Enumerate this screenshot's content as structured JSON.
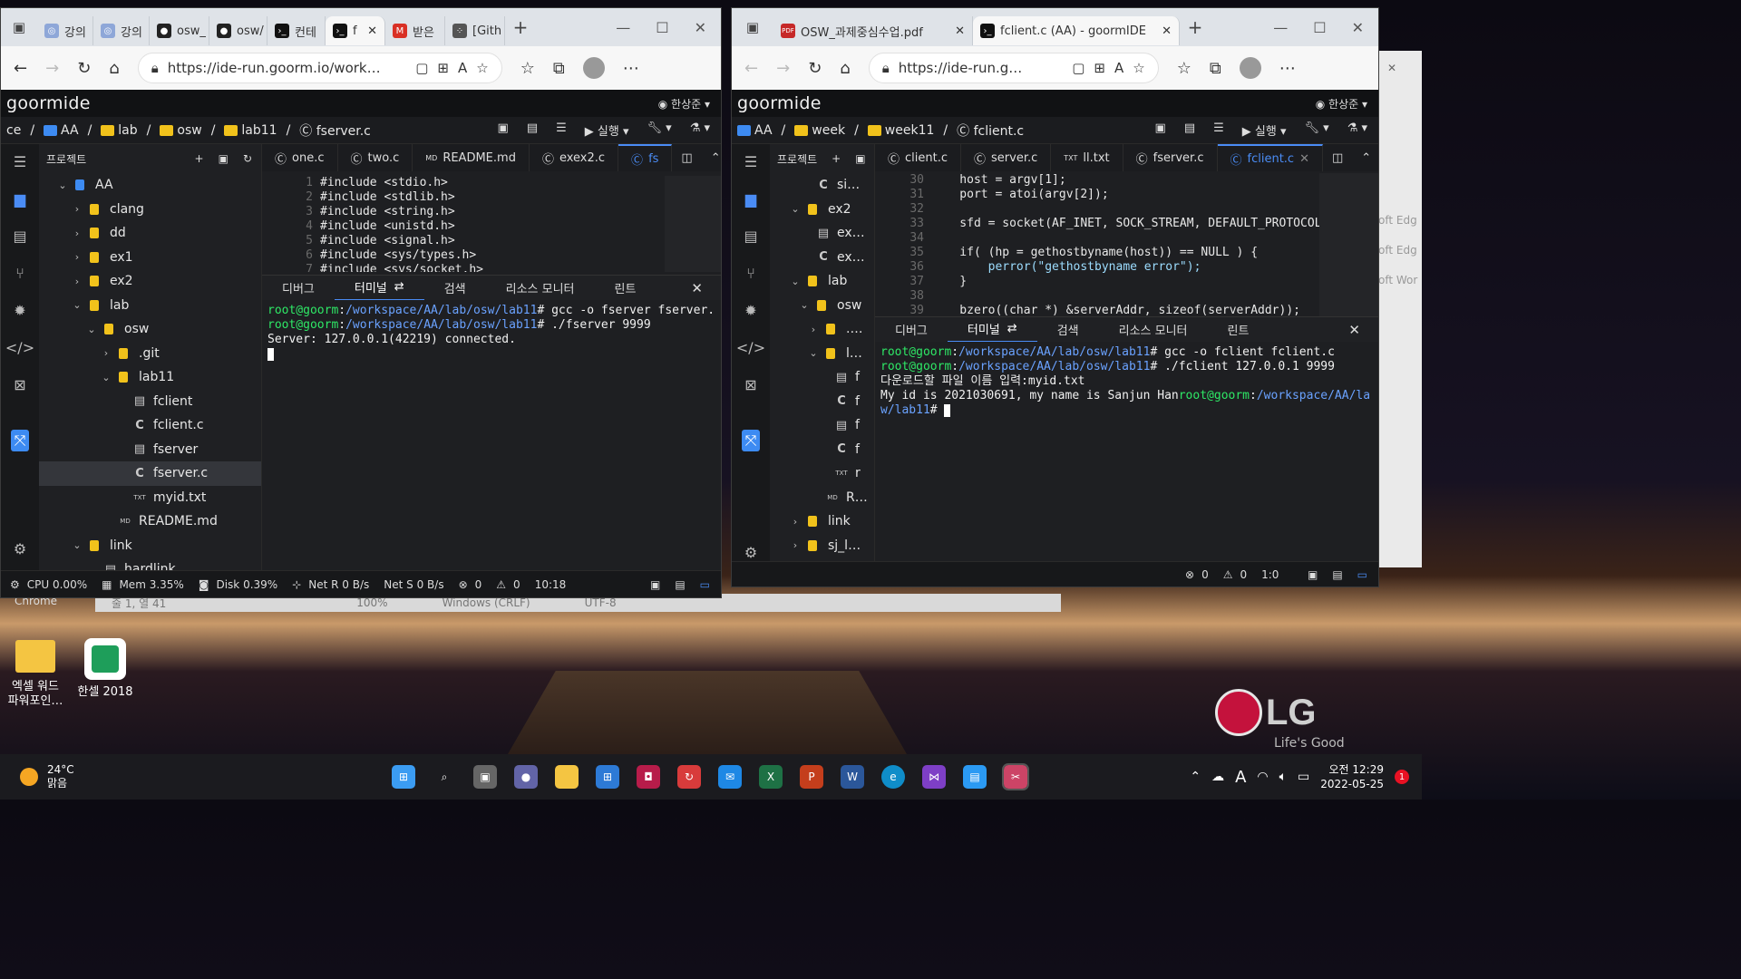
{
  "left": {
    "browser_tabs": [
      "강의",
      "강의",
      "osw_",
      "osw/",
      "컨테",
      "f",
      "받은",
      "[Gith"
    ],
    "url": "https://ide-run.goorm.io/work…",
    "logo": "goormide",
    "user": "한상준",
    "breadcrumb": [
      "ce",
      "AA",
      "lab",
      "osw",
      "lab11",
      "fserver.c"
    ],
    "run_label": "실행",
    "tree_title": "프로젝트",
    "tree": [
      {
        "label": "AA",
        "depth": 0,
        "type": "folder-open",
        "icon": "folder-blue-icon"
      },
      {
        "label": "clang",
        "depth": 1,
        "type": "folder"
      },
      {
        "label": "dd",
        "depth": 1,
        "type": "folder"
      },
      {
        "label": "ex1",
        "depth": 1,
        "type": "folder"
      },
      {
        "label": "ex2",
        "depth": 1,
        "type": "folder"
      },
      {
        "label": "lab",
        "depth": 1,
        "type": "folder-open"
      },
      {
        "label": "osw",
        "depth": 2,
        "type": "folder-open"
      },
      {
        "label": ".git",
        "depth": 3,
        "type": "folder"
      },
      {
        "label": "lab11",
        "depth": 3,
        "type": "folder-open"
      },
      {
        "label": "fclient",
        "depth": 4,
        "type": "file"
      },
      {
        "label": "fclient.c",
        "depth": 4,
        "type": "c"
      },
      {
        "label": "fserver",
        "depth": 4,
        "type": "file"
      },
      {
        "label": "fserver.c",
        "depth": 4,
        "type": "c",
        "selected": true
      },
      {
        "label": "myid.txt",
        "depth": 4,
        "type": "txt"
      },
      {
        "label": "README.md",
        "depth": 3,
        "type": "md"
      },
      {
        "label": "link",
        "depth": 1,
        "type": "folder-open"
      },
      {
        "label": "hardlink",
        "depth": 2,
        "type": "file"
      }
    ],
    "editor_tabs": [
      "one.c",
      "two.c",
      "README.md",
      "exex2.c",
      "fs"
    ],
    "code": [
      {
        "n": "1",
        "t": "#include <stdio.h>"
      },
      {
        "n": "2",
        "t": "#include <stdlib.h>"
      },
      {
        "n": "3",
        "t": "#include <string.h>"
      },
      {
        "n": "4",
        "t": "#include <unistd.h>"
      },
      {
        "n": "5",
        "t": "#include <signal.h>"
      },
      {
        "n": "6",
        "t": "#include <sys/types.h>"
      },
      {
        "n": "7",
        "t": "#include <sys/socket.h>"
      }
    ],
    "panel_tabs": [
      "디버그",
      "터미널",
      "검색",
      "리소스 모니터",
      "린트"
    ],
    "terminal": [
      {
        "user": "root@goorm",
        "path": "/workspace/AA/lab/osw/lab11",
        "cmd": "# gcc -o fserver fserver.c"
      },
      {
        "user": "root@goorm",
        "path": "/workspace/AA/lab/osw/lab11",
        "cmd": "# ./fserver 9999"
      },
      {
        "text": "Server: 127.0.0.1(42219) connected."
      }
    ],
    "status": {
      "cpu": "CPU 0.00%",
      "mem": "Mem 3.35%",
      "disk": "Disk 0.39%",
      "netr": "Net R 0 B/s",
      "nets": "Net S 0 B/s",
      "errors": "0",
      "warnings": "0",
      "pos": "10:18"
    }
  },
  "right": {
    "browser_tabs": [
      "OSW_과제중심수업.pdf",
      "fclient.c (AA) - goormIDE"
    ],
    "url": "https://ide-run.g…",
    "logo": "goormide",
    "user": "한상준",
    "breadcrumb": [
      "AA",
      "week",
      "week11",
      "fclient.c"
    ],
    "run_label": "실행",
    "tree_title": "프로젝트",
    "tree": [
      {
        "label": "si…",
        "depth": 3,
        "type": "c"
      },
      {
        "label": "ex2",
        "depth": 2,
        "type": "folder-open"
      },
      {
        "label": "ex…",
        "depth": 3,
        "type": "file"
      },
      {
        "label": "ex…",
        "depth": 3,
        "type": "c"
      },
      {
        "label": "lab",
        "depth": 2,
        "type": "folder-open"
      },
      {
        "label": "osw",
        "depth": 3,
        "type": "folder-open"
      },
      {
        "label": ".…",
        "depth": 4,
        "type": "folder"
      },
      {
        "label": "l…",
        "depth": 4,
        "type": "folder-open"
      },
      {
        "label": "f",
        "depth": 5,
        "type": "file"
      },
      {
        "label": "f",
        "depth": 5,
        "type": "c"
      },
      {
        "label": "f",
        "depth": 5,
        "type": "file"
      },
      {
        "label": "f",
        "depth": 5,
        "type": "c"
      },
      {
        "label": "r",
        "depth": 5,
        "type": "txt"
      },
      {
        "label": "R…",
        "depth": 4,
        "type": "md"
      },
      {
        "label": "link",
        "depth": 2,
        "type": "folder"
      },
      {
        "label": "sj_l…",
        "depth": 2,
        "type": "folder"
      }
    ],
    "editor_tabs": [
      "client.c",
      "server.c",
      "ll.txt",
      "fserver.c",
      "fclient.c"
    ],
    "code": [
      {
        "n": "30",
        "t": "    host = argv[1];"
      },
      {
        "n": "31",
        "t": "    port = atoi(argv[2]);"
      },
      {
        "n": "32",
        "t": ""
      },
      {
        "n": "33",
        "t": "    sfd = socket(AF_INET, SOCK_STREAM, DEFAULT_PROTOCOL"
      },
      {
        "n": "34",
        "t": ""
      },
      {
        "n": "35",
        "t": "    if( (hp = gethostbyname(host)) == NULL ) {"
      },
      {
        "n": "36",
        "t": "        perror(\"gethostbyname error\");"
      },
      {
        "n": "37",
        "t": "    }"
      },
      {
        "n": "38",
        "t": ""
      },
      {
        "n": "39",
        "t": "    bzero((char *) &serverAddr, sizeof(serverAddr));"
      }
    ],
    "panel_tabs": [
      "디버그",
      "터미널",
      "검색",
      "리소스 모니터",
      "린트"
    ],
    "terminal": [
      {
        "user": "root@goorm",
        "path": "/workspace/AA/lab/osw/lab11",
        "cmd": "# gcc -o fclient fclient.c"
      },
      {
        "user": "root@goorm",
        "path": "/workspace/AA/lab/osw/lab11",
        "cmd": "# ./fclient 127.0.0.1 9999"
      },
      {
        "text": "다운로드할 파일 이름 입력:myid.txt"
      },
      {
        "text": "My id is 2021030691, my name is Sanjun Han",
        "user": "root@goorm",
        "path": "/workspace/AA/lab/os"
      },
      {
        "path": "w/lab11",
        "cmd": "# "
      }
    ],
    "status": {
      "errors": "0",
      "warnings": "0",
      "pos": "1:0"
    }
  },
  "desktop": {
    "icons": [
      "엑셀 워드 파워포인…",
      "한셀 2018"
    ],
    "behind_text": [
      "Chrome",
      "줄 1, 열 41",
      "100%",
      "Windows (CRLF)",
      "UTF-8"
    ],
    "edge_text": [
      "oft Edg",
      "oft Edg",
      "oft Wor"
    ],
    "lg_brand": "LG",
    "lg_slogan": "Life's Good"
  },
  "taskbar": {
    "weather_temp": "24°C",
    "weather_text": "맑음",
    "time": "오전 12:29",
    "date": "2022-05-25",
    "notif": "1",
    "ime": "A"
  },
  "colors": {
    "accent": "#4a8cf5",
    "prompt_user": "#2ee866",
    "prompt_path": "#6aa2ff",
    "folder": "#f1c21b"
  }
}
